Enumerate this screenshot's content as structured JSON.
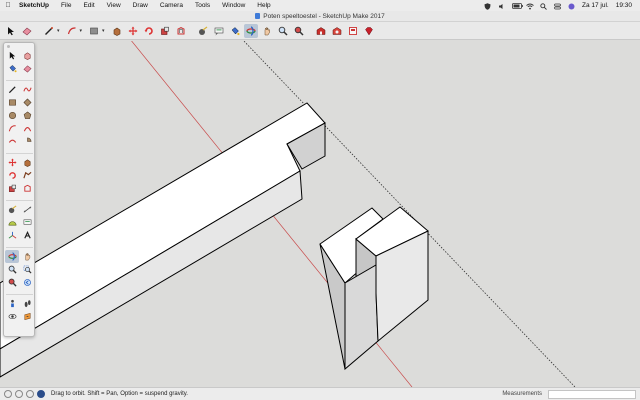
{
  "menubar": {
    "app_name": "SketchUp",
    "items": [
      "File",
      "Edit",
      "View",
      "Draw",
      "Camera",
      "Tools",
      "Window",
      "Help"
    ],
    "date": "Za 17 jul.",
    "time": "19:30"
  },
  "window": {
    "title": "Poten speeltoestel - SketchUp Make 2017"
  },
  "toolbar": {
    "icons": [
      "select-icon",
      "eraser-icon",
      "line-icon",
      "arc-icon",
      "shape-icon",
      "push-pull-icon",
      "move-icon",
      "rotate-icon",
      "scale-icon",
      "offset-icon",
      "tape-measure-icon",
      "text-icon",
      "paint-bucket-icon",
      "orbit-icon",
      "pan-icon",
      "zoom-icon",
      "zoom-extents-icon",
      "warehouse-icon",
      "extension-warehouse-icon",
      "layout-icon",
      "ruby-icon"
    ],
    "active_tool": "orbit-icon"
  },
  "statusbar": {
    "hint": "Drag to orbit.  Shift = Pan, Option = suspend gravity.",
    "measurements_label": "Measurements",
    "measurements_value": ""
  },
  "colors": {
    "canvas": "#dcdcda",
    "axis_red": "#c84a4a",
    "axis_green_dotted": "#333333",
    "face_top": "#ffffff",
    "face_left": "#d0d0d0",
    "face_right": "#e6e6e6"
  }
}
